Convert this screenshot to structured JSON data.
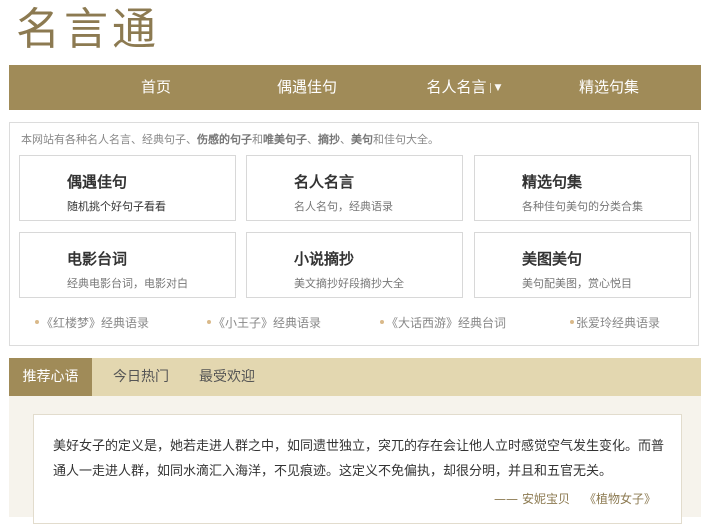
{
  "logo": {
    "text": "名言通"
  },
  "nav": {
    "items": [
      {
        "label": "首页"
      },
      {
        "label": "偶遇佳句"
      },
      {
        "label": "名人名言"
      },
      {
        "label": "精选句集"
      }
    ],
    "caret": "▼"
  },
  "intro": {
    "p1": "本网站有各种名人名言、经典句子、",
    "b1": "伤感的句子",
    "p2": "和",
    "b2": "唯美句子",
    "p3": "、",
    "b3": "摘抄",
    "p4": "、",
    "b4": "美句",
    "p5": "和佳句大全。"
  },
  "cards": [
    {
      "title": "偶遇佳句",
      "desc": "随机挑个好句子看看"
    },
    {
      "title": "名人名言",
      "desc": "名人名句，经典语录"
    },
    {
      "title": "精选句集",
      "desc": "各种佳句美句的分类合集"
    },
    {
      "title": "电影台词",
      "desc": "经典电影台词，电影对白"
    },
    {
      "title": "小说摘抄",
      "desc": "美文摘抄好段摘抄大全"
    },
    {
      "title": "美图美句",
      "desc": "美句配美图，赏心悦目"
    }
  ],
  "links": [
    {
      "label": "《红楼梦》经典语录"
    },
    {
      "label": "《小王子》经典语录"
    },
    {
      "label": "《大话西游》经典台词"
    },
    {
      "label": "张爱玲经典语录"
    }
  ],
  "tabs": [
    {
      "label": "推荐心语"
    },
    {
      "label": "今日热门"
    },
    {
      "label": "最受欢迎"
    }
  ],
  "quote": {
    "text": "美好女子的定义是，她若走进人群之中，如同遗世独立，突兀的存在会让他人立时感觉空气发生变化。而普通人一走进人群，如同水滴汇入海洋，不见痕迹。这定义不免偏执，却很分明，并且和五官无关。",
    "dash": "——",
    "author": "安妮宝贝",
    "book": "《植物女子》"
  },
  "colors": {
    "brand": "#a08b58",
    "tab_bar": "#e3d7b0",
    "logo": "#8c7a51"
  }
}
